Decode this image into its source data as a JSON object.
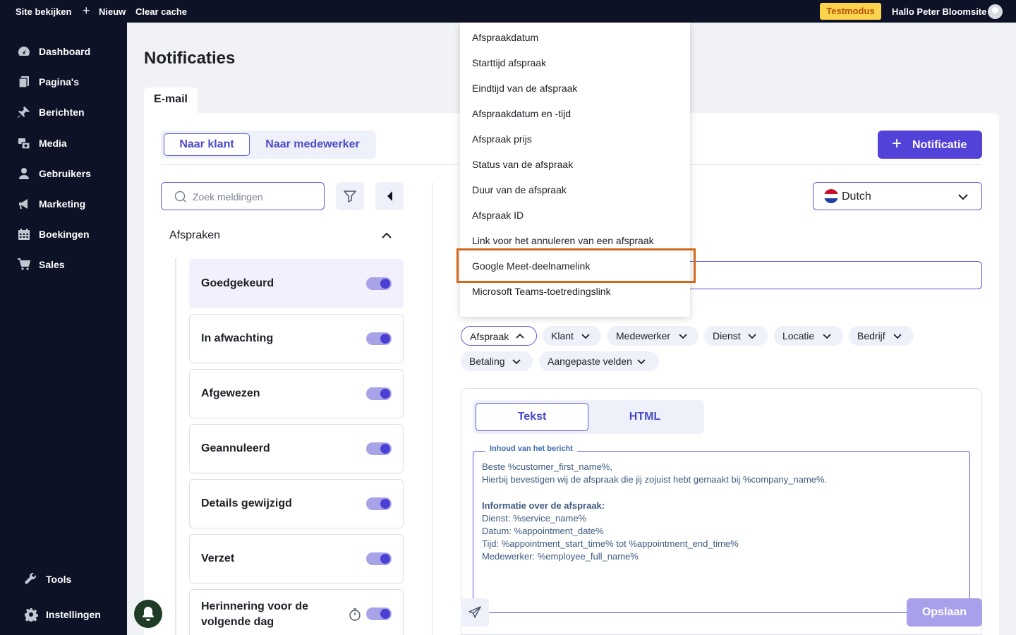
{
  "admin_bar": {
    "view_site": "Site bekijken",
    "new": "Nieuw",
    "clear_cache": "Clear cache",
    "test_mode": "Testmodus",
    "greeting": "Hallo Peter Bloomsite"
  },
  "sidebar": {
    "items": [
      {
        "label": "Dashboard",
        "icon": "dashboard-icon"
      },
      {
        "label": "Pagina's",
        "icon": "pages-icon"
      },
      {
        "label": "Berichten",
        "icon": "pin-icon"
      },
      {
        "label": "Media",
        "icon": "media-icon"
      },
      {
        "label": "Gebruikers",
        "icon": "user-icon"
      },
      {
        "label": "Marketing",
        "icon": "megaphone-icon"
      },
      {
        "label": "Boekingen",
        "icon": "calendar-icon"
      },
      {
        "label": "Sales",
        "icon": "cart-icon"
      }
    ],
    "bottom_items": [
      {
        "label": "Tools",
        "icon": "wrench-icon"
      },
      {
        "label": "Instellingen",
        "icon": "gear-icon"
      }
    ]
  },
  "page": {
    "title": "Notificaties",
    "tab": "E-mail"
  },
  "recipient_toggle": {
    "customer": "Naar klant",
    "employee": "Naar medewerker"
  },
  "add_notification": "Notificatie",
  "search": {
    "placeholder": "Zoek meldingen",
    "value": ""
  },
  "group": {
    "title": "Afspraken"
  },
  "notifications": [
    {
      "label": "Goedgekeurd",
      "enabled": true
    },
    {
      "label": "In afwachting",
      "enabled": true
    },
    {
      "label": "Afgewezen",
      "enabled": true
    },
    {
      "label": "Geannuleerd",
      "enabled": true
    },
    {
      "label": "Details gewijzigd",
      "enabled": true
    },
    {
      "label": "Verzet",
      "enabled": true
    },
    {
      "label": "Herinnering voor de volgende dag",
      "enabled": true
    }
  ],
  "language": {
    "selected": "Dutch"
  },
  "placeholder_pills": [
    "Afspraak",
    "Klant",
    "Medewerker",
    "Dienst",
    "Locatie",
    "Bedrijf",
    "Betaling",
    "Aangepaste velden"
  ],
  "editor": {
    "mode_text": "Tekst",
    "mode_html": "HTML",
    "legend": "Inhoud van het bericht",
    "line1": "Beste %customer_first_name%,",
    "line2": "Hierbij bevestigen wij de afspraak die jij zojuist hebt gemaakt bij %company_name%.",
    "heading": "Informatie over de afspraak:",
    "line3": "Dienst: %service_name%",
    "line4": "Datum: %appointment_date%",
    "line5": "Tijd: %appointment_start_time% tot %appointment_end_time%",
    "line6": "Medewerker: %employee_full_name%"
  },
  "save": "Opslaan",
  "dropdown": {
    "items": [
      "Afspraakdatum",
      "Starttijd afspraak",
      "Eindtijd van de afspraak",
      "Afspraakdatum en -tijd",
      "Afspraak prijs",
      "Status van de afspraak",
      "Duur van de afspraak",
      "Afspraak ID",
      "Link voor het annuleren van een afspraak",
      "Google Meet-deelnamelink",
      "Microsoft Teams-toetredingslink"
    ]
  },
  "colors": {
    "primary": "#5242d8",
    "sidebar": "#0d1227",
    "highlight": "#d2691e",
    "test_mode": "#fcd34d"
  }
}
